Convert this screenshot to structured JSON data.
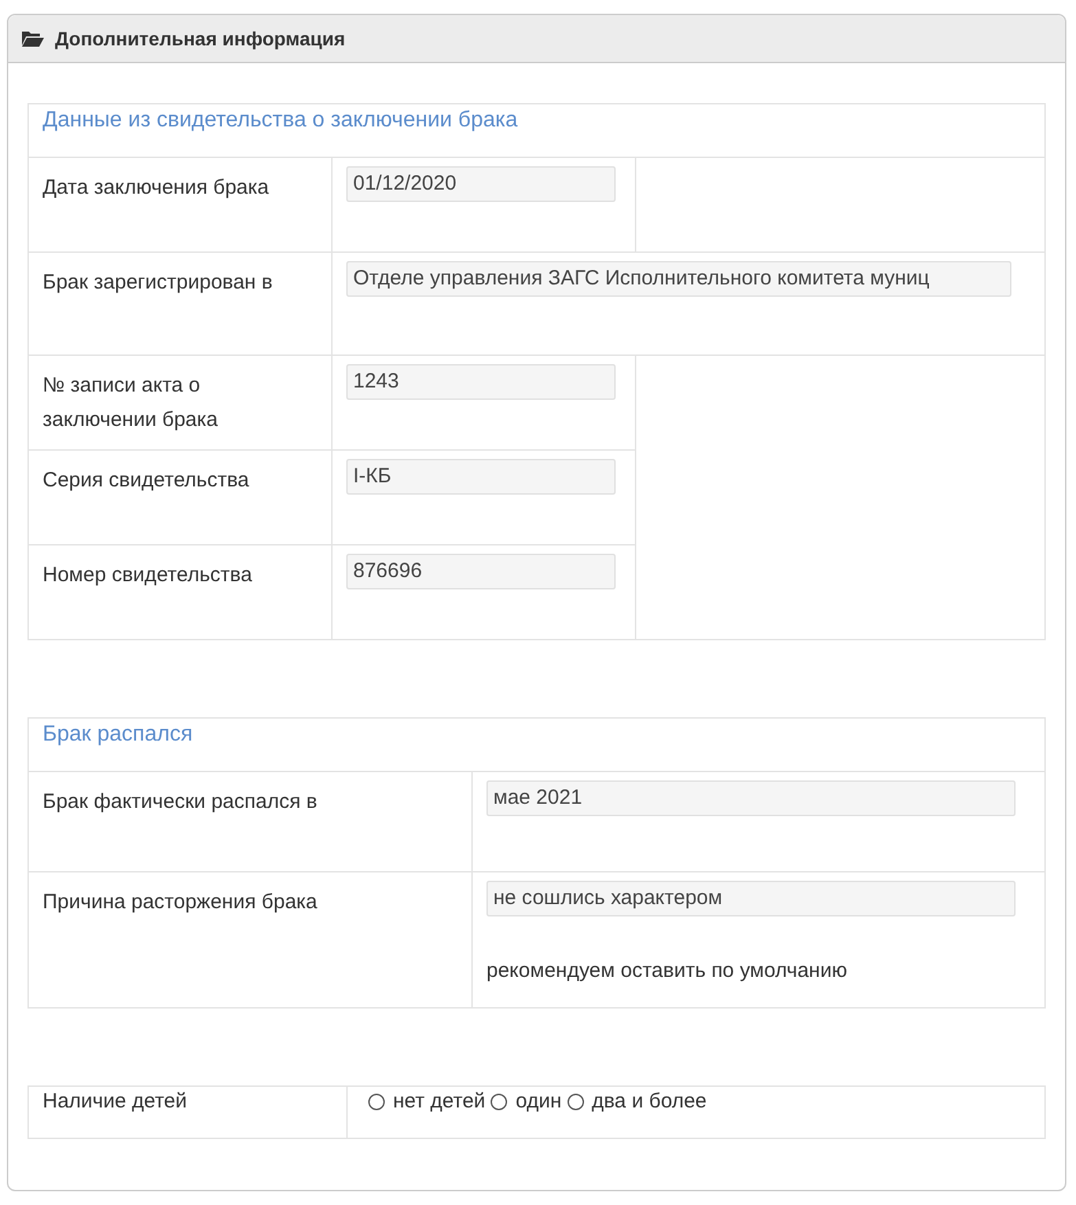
{
  "panel": {
    "title": "Дополнительная информация"
  },
  "marriage_certificate": {
    "title": "Данные из свидетельства о заключении брака",
    "rows": [
      {
        "label": "Дата заключения брака",
        "value": "01/12/2020",
        "kind": "short"
      },
      {
        "label": "Брак зарегистрирован в",
        "value": "Отделе управления ЗАГС Исполнительного комитета муниц",
        "kind": "wide"
      },
      {
        "label": "№  записи акта о заключении брака",
        "value": "1243",
        "kind": "short"
      },
      {
        "label": "Серия свидетельства",
        "value": "I-КБ",
        "kind": "short"
      },
      {
        "label": "Номер свидетельства",
        "value": "876696",
        "kind": "short"
      }
    ]
  },
  "divorce": {
    "title": "Брак распался",
    "rows": [
      {
        "label": "Брак фактически распался в",
        "value": "мае 2021"
      },
      {
        "label": "Причина расторжения брака",
        "value": "не сошлись характером",
        "hint": "рекомендуем оставить по умолчанию"
      }
    ]
  },
  "children": {
    "label": "Наличие детей",
    "options": [
      {
        "label": "нет детей",
        "selected": false
      },
      {
        "label": "один",
        "selected": false
      },
      {
        "label": "два и более",
        "selected": false
      }
    ]
  }
}
